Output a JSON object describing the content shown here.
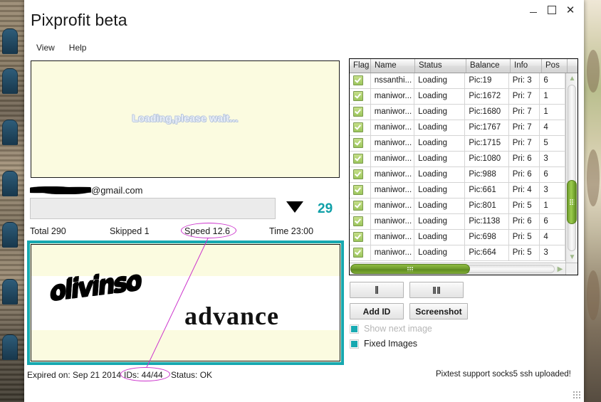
{
  "window": {
    "title": "Pixprofit beta",
    "controls": {
      "minimize": "minimize-icon",
      "maximize": "maximize-icon",
      "close": "close-icon"
    }
  },
  "menubar": {
    "items": [
      {
        "label": "View"
      },
      {
        "label": "Help"
      }
    ]
  },
  "loading_panel": {
    "text": "Loading,please wait..."
  },
  "account": {
    "email_suffix": "@gmail.com",
    "email_redacted": true,
    "progress_value": "",
    "dropdown_icon": "chevron-down-icon",
    "counter": "29",
    "counter_color": "#10a0a8"
  },
  "stats": {
    "total": "Total 290",
    "skipped": "Skipped 1",
    "speed": "Speed 12.6",
    "time": "Time 23:00"
  },
  "captcha": {
    "word_primary": "olivinso",
    "word_secondary": "advance",
    "border_color": "#17a8b0"
  },
  "footer": {
    "expired": "Expired on: Sep 21 2014",
    "ids": "IDs: 44/44",
    "status": "Status: OK",
    "support": "Pixtest support socks5  ssh uploaded!"
  },
  "grid": {
    "columns": [
      "Flag",
      "Name",
      "Status",
      "Balance",
      "Info",
      "Pos"
    ],
    "rows": [
      {
        "flag": "checked",
        "name": "nssanthi...",
        "status": "Loading",
        "balance": "Pic:19",
        "info": "Pri: 3",
        "pos": "6"
      },
      {
        "flag": "checked",
        "name": "maniwor...",
        "status": "Loading",
        "balance": "Pic:1672",
        "info": "Pri: 7",
        "pos": "1"
      },
      {
        "flag": "checked",
        "name": "maniwor...",
        "status": "Loading",
        "balance": "Pic:1680",
        "info": "Pri: 7",
        "pos": "1"
      },
      {
        "flag": "checked",
        "name": "maniwor...",
        "status": "Loading",
        "balance": "Pic:1767",
        "info": "Pri: 7",
        "pos": "4"
      },
      {
        "flag": "checked",
        "name": "maniwor...",
        "status": "Loading",
        "balance": "Pic:1715",
        "info": "Pri: 7",
        "pos": "5"
      },
      {
        "flag": "checked",
        "name": "maniwor...",
        "status": "Loading",
        "balance": "Pic:1080",
        "info": "Pri: 6",
        "pos": "3"
      },
      {
        "flag": "checked",
        "name": "maniwor...",
        "status": "Loading",
        "balance": "Pic:988",
        "info": "Pri: 6",
        "pos": "6"
      },
      {
        "flag": "checked",
        "name": "maniwor...",
        "status": "Loading",
        "balance": "Pic:661",
        "info": "Pri: 4",
        "pos": "3"
      },
      {
        "flag": "checked",
        "name": "maniwor...",
        "status": "Loading",
        "balance": "Pic:801",
        "info": "Pri: 5",
        "pos": "1"
      },
      {
        "flag": "checked",
        "name": "maniwor...",
        "status": "Loading",
        "balance": "Pic:1138",
        "info": "Pri: 6",
        "pos": "6"
      },
      {
        "flag": "checked",
        "name": "maniwor...",
        "status": "Loading",
        "balance": "Pic:698",
        "info": "Pri: 5",
        "pos": "4"
      },
      {
        "flag": "checked",
        "name": "maniwor...",
        "status": "Loading",
        "balance": "Pic:664",
        "info": "Pri: 5",
        "pos": "3"
      }
    ],
    "scrollbar_color": "#6f9b2c"
  },
  "controls": {
    "start_icon": "stop-bar-icon",
    "pause_icon": "pause-bars-icon",
    "add_id": "Add ID",
    "screenshot": "Screenshot",
    "show_next_image": "Show next image",
    "show_next_image_enabled": false,
    "fixed_images": "Fixed Images",
    "fixed_images_enabled": true,
    "checkbox_color": "#17a8b0"
  },
  "annotations": {
    "color": "#cc33cc",
    "highlights": [
      "Speed 12.6",
      "IDs: 44/44"
    ]
  }
}
